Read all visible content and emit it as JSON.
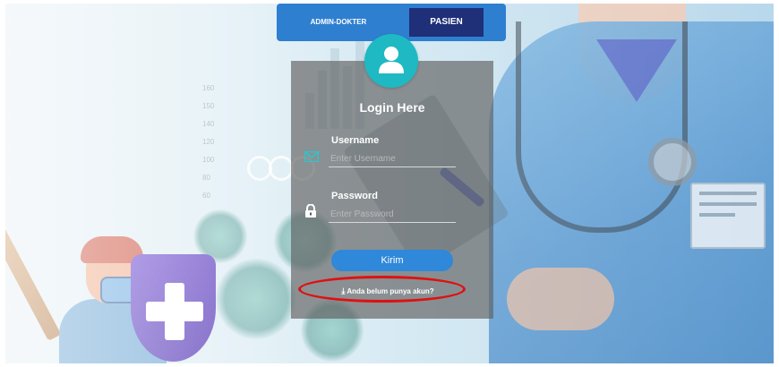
{
  "role_tabs": {
    "admin_label": "ADMIN-DOKTER",
    "patient_label": "PASIEN",
    "active": "PASIEN"
  },
  "login": {
    "title": "Login Here",
    "username_label": "Username",
    "username_placeholder": "Enter Username",
    "password_label": "Password",
    "password_placeholder": "Enter Password",
    "submit_label": "Kirim",
    "register_link": "Anda belum punya akun?"
  },
  "background": {
    "chart_ticks": [
      "160",
      "150",
      "140",
      "120",
      "100",
      "80",
      "60"
    ]
  },
  "icons": {
    "avatar": "user-icon",
    "username": "envelope-icon",
    "password": "lock-icon",
    "register": "download-icon"
  },
  "colors": {
    "tab_bar": "#2e7fd0",
    "tab_active": "#1f2f78",
    "avatar": "#1eb9c2",
    "submit": "#2f88d9",
    "highlight": "#e01010"
  }
}
